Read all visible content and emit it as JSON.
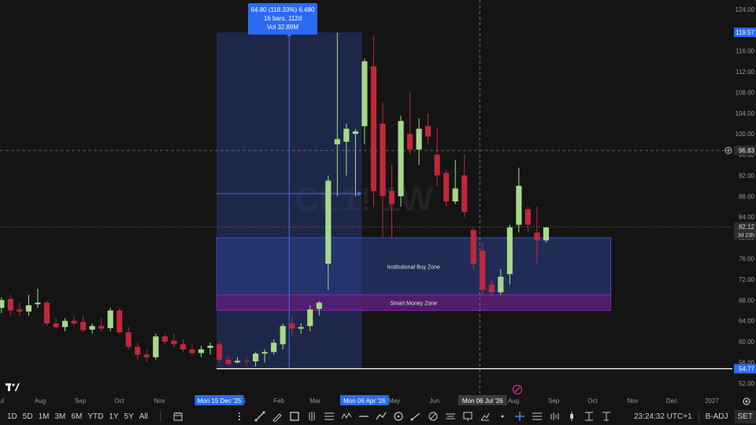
{
  "chart_data": {
    "type": "candlestick",
    "watermark": "CL1! 1W",
    "ylim": [
      50.0,
      125.8
    ],
    "y_ticks": [
      {
        "v": 52.0,
        "label": "52.00"
      },
      {
        "v": 56.0,
        "label": "56.00"
      },
      {
        "v": 60.0,
        "label": "60.00"
      },
      {
        "v": 64.0,
        "label": "64.00"
      },
      {
        "v": 68.0,
        "label": "68.00"
      },
      {
        "v": 72.0,
        "label": "72.00"
      },
      {
        "v": 76.0,
        "label": "76.00"
      },
      {
        "v": 80.0,
        "label": "80.00"
      },
      {
        "v": 84.0,
        "label": "84.00"
      },
      {
        "v": 88.0,
        "label": "88.00"
      },
      {
        "v": 92.0,
        "label": "92.00"
      },
      {
        "v": 96.0,
        "label": "96.00"
      },
      {
        "v": 100.0,
        "label": "100.00"
      },
      {
        "v": 104.0,
        "label": "104.00"
      },
      {
        "v": 108.0,
        "label": "108.00"
      },
      {
        "v": 112.0,
        "label": "112.00"
      },
      {
        "v": 116.0,
        "label": "116.00"
      },
      {
        "v": 120.0,
        "label": "120.00"
      },
      {
        "v": 124.0,
        "label": "124.00"
      }
    ],
    "x_start": "2025-07-01",
    "x_end": "2027-02-04",
    "x_ticks": [
      {
        "date": "2025-07-01",
        "label": "Jul"
      },
      {
        "date": "2025-08-01",
        "label": "Aug"
      },
      {
        "date": "2025-09-01",
        "label": "Sep"
      },
      {
        "date": "2025-10-01",
        "label": "Oct"
      },
      {
        "date": "2025-11-01",
        "label": "Nov"
      },
      {
        "date": "2026-01-01",
        "label": "2026"
      },
      {
        "date": "2026-02-01",
        "label": "Feb"
      },
      {
        "date": "2026-03-01",
        "label": "Mar"
      },
      {
        "date": "2026-05-01",
        "label": "May"
      },
      {
        "date": "2026-06-01",
        "label": "Jun"
      },
      {
        "date": "2026-08-01",
        "label": "Aug"
      },
      {
        "date": "2026-09-01",
        "label": "Sep"
      },
      {
        "date": "2026-10-01",
        "label": "Oct"
      },
      {
        "date": "2026-11-01",
        "label": "Nov"
      },
      {
        "date": "2026-12-01",
        "label": "Dec"
      },
      {
        "date": "2027-01-01",
        "label": "2027"
      }
    ],
    "x_badges": [
      {
        "date": "2025-12-15",
        "label": "Mon 15 Dec '25",
        "color": "#2a6bf2"
      },
      {
        "date": "2026-04-06",
        "label": "Mon 06 Apr '26",
        "color": "#2a6bf2"
      },
      {
        "date": "2026-07-06",
        "label": "Mon 06 Jul '26",
        "color": "#3a3a3a"
      }
    ],
    "candles": [
      {
        "date": "2025-06-30",
        "o": 66.5,
        "h": 68.5,
        "l": 65.5,
        "c": 68.0
      },
      {
        "date": "2025-07-07",
        "o": 68.2,
        "h": 69.0,
        "l": 65.0,
        "c": 66.0
      },
      {
        "date": "2025-07-14",
        "o": 66.2,
        "h": 67.5,
        "l": 65.0,
        "c": 65.8
      },
      {
        "date": "2025-07-21",
        "o": 65.8,
        "h": 69.0,
        "l": 65.0,
        "c": 67.0
      },
      {
        "date": "2025-07-28",
        "o": 67.2,
        "h": 70.2,
        "l": 66.5,
        "c": 67.5
      },
      {
        "date": "2025-08-04",
        "o": 67.5,
        "h": 67.8,
        "l": 63.0,
        "c": 63.5
      },
      {
        "date": "2025-08-11",
        "o": 63.5,
        "h": 64.5,
        "l": 62.5,
        "c": 62.8
      },
      {
        "date": "2025-08-18",
        "o": 62.8,
        "h": 64.5,
        "l": 62.0,
        "c": 64.0
      },
      {
        "date": "2025-08-25",
        "o": 64.0,
        "h": 65.0,
        "l": 63.0,
        "c": 63.5
      },
      {
        "date": "2025-09-01",
        "o": 63.8,
        "h": 65.0,
        "l": 61.8,
        "c": 62.2
      },
      {
        "date": "2025-09-08",
        "o": 62.3,
        "h": 63.5,
        "l": 61.5,
        "c": 63.0
      },
      {
        "date": "2025-09-15",
        "o": 63.0,
        "h": 64.5,
        "l": 62.0,
        "c": 62.5
      },
      {
        "date": "2025-09-22",
        "o": 62.6,
        "h": 66.5,
        "l": 62.0,
        "c": 66.0
      },
      {
        "date": "2025-09-29",
        "o": 66.0,
        "h": 66.5,
        "l": 61.5,
        "c": 61.8
      },
      {
        "date": "2025-10-06",
        "o": 61.8,
        "h": 62.8,
        "l": 58.5,
        "c": 59.0
      },
      {
        "date": "2025-10-13",
        "o": 59.0,
        "h": 59.8,
        "l": 56.5,
        "c": 57.5
      },
      {
        "date": "2025-10-20",
        "o": 57.5,
        "h": 58.5,
        "l": 56.0,
        "c": 57.0
      },
      {
        "date": "2025-10-27",
        "o": 57.0,
        "h": 61.5,
        "l": 56.5,
        "c": 61.0
      },
      {
        "date": "2025-11-03",
        "o": 61.0,
        "h": 61.6,
        "l": 59.5,
        "c": 60.0
      },
      {
        "date": "2025-11-10",
        "o": 60.2,
        "h": 61.5,
        "l": 59.0,
        "c": 59.5
      },
      {
        "date": "2025-11-17",
        "o": 59.5,
        "h": 60.5,
        "l": 58.0,
        "c": 58.5
      },
      {
        "date": "2025-11-24",
        "o": 58.5,
        "h": 59.5,
        "l": 57.5,
        "c": 57.8
      },
      {
        "date": "2025-12-01",
        "o": 57.8,
        "h": 59.2,
        "l": 57.0,
        "c": 58.5
      },
      {
        "date": "2025-12-08",
        "o": 58.8,
        "h": 59.8,
        "l": 57.5,
        "c": 59.2
      },
      {
        "date": "2025-12-15",
        "o": 59.5,
        "h": 60.0,
        "l": 56.0,
        "c": 56.5
      },
      {
        "date": "2025-12-22",
        "o": 56.5,
        "h": 57.2,
        "l": 55.5,
        "c": 55.7
      },
      {
        "date": "2025-12-29",
        "o": 56.0,
        "h": 57.0,
        "l": 55.8,
        "c": 56.3
      },
      {
        "date": "2026-01-05",
        "o": 56.3,
        "h": 57.0,
        "l": 55.5,
        "c": 56.2
      },
      {
        "date": "2026-01-12",
        "o": 56.2,
        "h": 58.0,
        "l": 55.2,
        "c": 57.7
      },
      {
        "date": "2026-01-19",
        "o": 57.7,
        "h": 58.5,
        "l": 56.0,
        "c": 58.0
      },
      {
        "date": "2026-01-26",
        "o": 58.0,
        "h": 60.5,
        "l": 57.5,
        "c": 59.8
      },
      {
        "date": "2026-02-02",
        "o": 59.5,
        "h": 63.5,
        "l": 58.5,
        "c": 63.0
      },
      {
        "date": "2026-02-09",
        "o": 63.5,
        "h": 64.8,
        "l": 61.0,
        "c": 62.5
      },
      {
        "date": "2026-02-16",
        "o": 62.5,
        "h": 63.5,
        "l": 61.5,
        "c": 62.8
      },
      {
        "date": "2026-02-23",
        "o": 63.0,
        "h": 67.0,
        "l": 62.0,
        "c": 66.2
      },
      {
        "date": "2026-03-02",
        "o": 66.3,
        "h": 67.8,
        "l": 65.0,
        "c": 67.5
      },
      {
        "date": "2026-03-09",
        "o": 75.0,
        "h": 92.0,
        "l": 70.0,
        "c": 91.0
      },
      {
        "date": "2026-03-16",
        "o": 98.0,
        "h": 119.5,
        "l": 88.0,
        "c": 99.0
      },
      {
        "date": "2026-03-23",
        "o": 98.5,
        "h": 102.0,
        "l": 92.0,
        "c": 101.0
      },
      {
        "date": "2026-03-30",
        "o": 100.0,
        "h": 101.0,
        "l": 88.0,
        "c": 100.5
      },
      {
        "date": "2026-04-06",
        "o": 101.5,
        "h": 114.5,
        "l": 98.0,
        "c": 114.0
      },
      {
        "date": "2026-04-13",
        "o": 113.0,
        "h": 119.0,
        "l": 86.0,
        "c": 89.0
      },
      {
        "date": "2026-04-20",
        "o": 102.0,
        "h": 106.0,
        "l": 80.0,
        "c": 88.0
      },
      {
        "date": "2026-04-27",
        "o": 89.0,
        "h": 94.0,
        "l": 80.0,
        "c": 86.5
      },
      {
        "date": "2026-05-04",
        "o": 88.0,
        "h": 103.5,
        "l": 86.0,
        "c": 102.5
      },
      {
        "date": "2026-05-11",
        "o": 100.0,
        "h": 108.0,
        "l": 96.0,
        "c": 97.0
      },
      {
        "date": "2026-05-18",
        "o": 97.0,
        "h": 103.0,
        "l": 94.0,
        "c": 101.0
      },
      {
        "date": "2026-05-25",
        "o": 101.5,
        "h": 104.0,
        "l": 98.0,
        "c": 99.5
      },
      {
        "date": "2026-06-01",
        "o": 96.0,
        "h": 101.0,
        "l": 90.0,
        "c": 92.0
      },
      {
        "date": "2026-06-08",
        "o": 92.5,
        "h": 93.0,
        "l": 86.0,
        "c": 87.0
      },
      {
        "date": "2026-06-15",
        "o": 87.0,
        "h": 95.0,
        "l": 86.5,
        "c": 89.5
      },
      {
        "date": "2026-06-22",
        "o": 92.0,
        "h": 96.0,
        "l": 84.0,
        "c": 85.0
      },
      {
        "date": "2026-06-29",
        "o": 81.5,
        "h": 82.0,
        "l": 74.0,
        "c": 75.0
      },
      {
        "date": "2026-07-06",
        "o": 77.5,
        "h": 79.0,
        "l": 69.0,
        "c": 70.0
      },
      {
        "date": "2026-07-13",
        "o": 71.0,
        "h": 72.0,
        "l": 68.5,
        "c": 69.5
      },
      {
        "date": "2026-07-20",
        "o": 69.5,
        "h": 74.0,
        "l": 69.0,
        "c": 72.5
      },
      {
        "date": "2026-07-27",
        "o": 73.0,
        "h": 82.5,
        "l": 71.0,
        "c": 82.0
      },
      {
        "date": "2026-08-03",
        "o": 82.5,
        "h": 93.5,
        "l": 81.0,
        "c": 90.0
      },
      {
        "date": "2026-08-10",
        "o": 85.5,
        "h": 86.0,
        "l": 81.0,
        "c": 82.5
      },
      {
        "date": "2026-08-17",
        "o": 81.0,
        "h": 86.0,
        "l": 75.0,
        "c": 79.5
      },
      {
        "date": "2026-08-24",
        "o": 79.5,
        "h": 82.0,
        "l": 79.0,
        "c": 82.0
      }
    ],
    "annotations": {
      "range_box": {
        "start": "2025-12-15",
        "end": "2026-04-06",
        "low": 54.77,
        "high": 119.57,
        "label_lines": [
          "64.80 (118.33%) 6,480",
          "16 bars, 112d",
          "Vol 32.89M"
        ]
      },
      "zones": [
        {
          "name": "Institutional Buy Zone",
          "start": "2025-12-15",
          "end": "2026-10-15",
          "low": 69.0,
          "high": 80.0
        },
        {
          "name": "Smart Money Zone",
          "start": "2025-12-15",
          "end": "2026-10-15",
          "low": 66.0,
          "high": 69.0
        }
      ],
      "hline": {
        "value": 54.77,
        "label": "54.77"
      },
      "crosshair": {
        "date": "2026-07-06",
        "value": 96.83,
        "label": "96.83"
      }
    },
    "price_labels": [
      {
        "value": 119.57,
        "label": "119.57",
        "color": "#2a6bf2",
        "text": "#ffffff"
      },
      {
        "value": 82.12,
        "label": "82.12",
        "sub": "3d 23h",
        "color": "#2e2e2e",
        "text": "#d0d0d0"
      }
    ],
    "colors": {
      "up": "#a7d98a",
      "down": "#c0283a",
      "zone_blue": "#2a3f8c",
      "zone_purple": "#5a1e78",
      "accent": "#2a6bf2"
    }
  },
  "toolbar": {
    "timeframes": [
      "1D",
      "5D",
      "1M",
      "3M",
      "6M",
      "YTD",
      "1Y",
      "5Y",
      "All"
    ],
    "time_status": "23:24:32 UTC+1",
    "adj_label": "B-ADJ",
    "set_label": "SET",
    "tool_icons": [
      "stepper-icon",
      "trendline-icon",
      "pencil-icon",
      "rectangle-icon",
      "pitchfork-icon",
      "fib-icon",
      "pattern-icon",
      "horizontal-line-icon",
      "path-icon",
      "circle-icon",
      "ray-icon",
      "arrow-icon",
      "parallel-channel-icon",
      "text-icon",
      "long-position-icon",
      "brush-icon",
      "dot-icon",
      "crosshair-icon",
      "regression-icon",
      "bars-pattern-icon",
      "projection-icon",
      "price-range-icon"
    ]
  }
}
